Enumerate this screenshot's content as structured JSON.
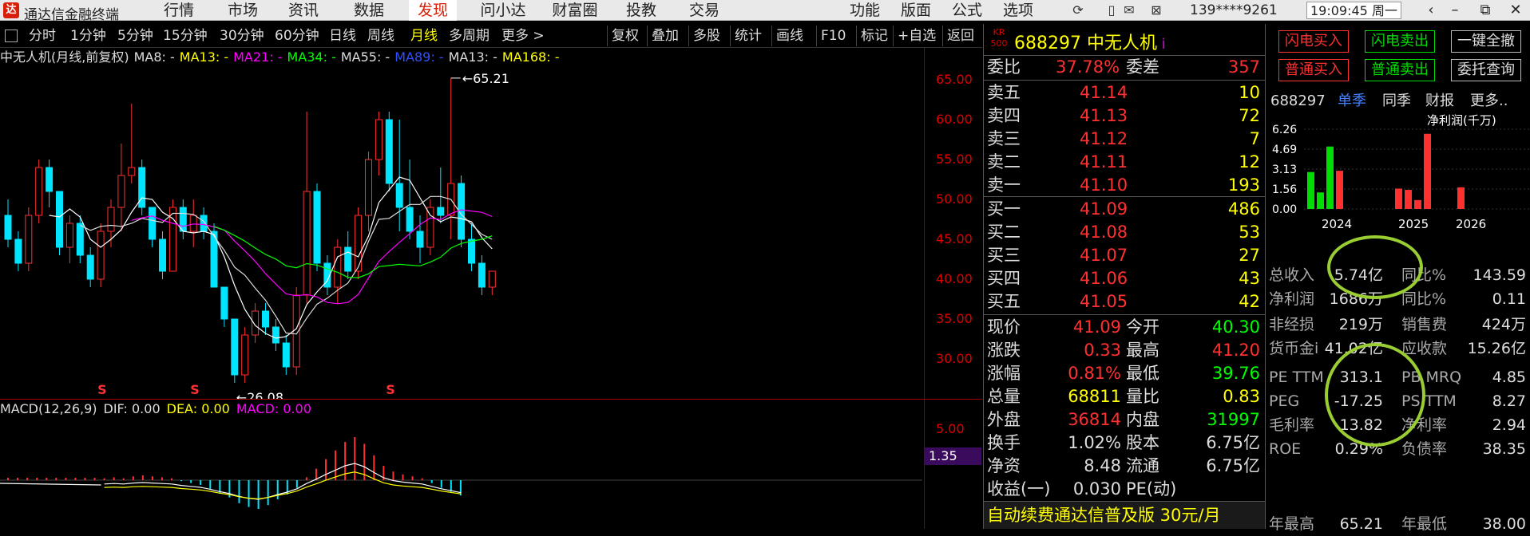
{
  "app": {
    "title": "通达信金融终端",
    "logo": "达"
  },
  "menu": [
    "行情",
    "市场",
    "资讯",
    "数据",
    "发现",
    "问小达",
    "财富圈",
    "投教",
    "交易"
  ],
  "menu_active": "发现",
  "right_menu": [
    "功能",
    "版面",
    "公式",
    "选项"
  ],
  "user_phone": "139****9261",
  "clock": "19:09:45 周一",
  "chart_toolbar": {
    "periods": [
      "分时",
      "1分钟",
      "5分钟",
      "15分钟",
      "30分钟",
      "60分钟",
      "日线",
      "周线",
      "月线",
      "多周期",
      "更多 >"
    ],
    "active": "月线",
    "tools": [
      "复权",
      "叠加",
      "多股",
      "统计",
      "画线",
      "F10",
      "标记",
      "+自选",
      "返回"
    ]
  },
  "ma_legend": [
    {
      "text": "中无人机(月线,前复权)",
      "color": "#dddddd"
    },
    {
      "text": "MA8: -",
      "color": "#dddddd"
    },
    {
      "text": "MA13: -",
      "color": "#ffff00"
    },
    {
      "text": "MA21: -",
      "color": "#ff00ff"
    },
    {
      "text": "MA34: -",
      "color": "#00ff00"
    },
    {
      "text": "MA55: -",
      "color": "#dddddd"
    },
    {
      "text": "MA89: -",
      "color": "#3050ff"
    },
    {
      "text": "MA13: -",
      "color": "#dddddd"
    },
    {
      "text": "MA168: -",
      "color": "#ffff00"
    }
  ],
  "macd_legend": [
    {
      "text": "MACD(12,26,9)",
      "color": "#dddddd"
    },
    {
      "text": "DIF: 0.00",
      "color": "#dddddd"
    },
    {
      "text": "DEA: 0.00",
      "color": "#ffff00"
    },
    {
      "text": "MACD: 0.00",
      "color": "#ff00ff"
    }
  ],
  "price_axis": [
    "65.00",
    "60.00",
    "55.00",
    "50.00",
    "45.00",
    "40.00",
    "35.00",
    "30.00"
  ],
  "macd_axis": [
    "5.00"
  ],
  "macd_axis_box": "1.35",
  "annotations": {
    "high": "65.21",
    "low": "26.08",
    "s_marks": [
      "S",
      "S",
      "S"
    ]
  },
  "chart_data": {
    "type": "candlestick",
    "title": "中无人机(月线,前复权)",
    "ylim": [
      25,
      67
    ],
    "candles": [
      [
        48,
        50,
        44,
        45
      ],
      [
        45,
        46,
        41,
        42
      ],
      [
        42,
        49,
        41,
        48
      ],
      [
        48,
        55,
        47,
        54
      ],
      [
        54,
        55,
        49,
        51
      ],
      [
        51,
        51,
        43,
        44
      ],
      [
        44,
        48,
        42,
        47
      ],
      [
        47,
        48,
        42,
        43
      ],
      [
        43,
        44,
        39,
        40
      ],
      [
        40,
        47,
        39,
        46
      ],
      [
        46,
        50,
        44,
        49
      ],
      [
        49,
        57,
        46,
        53
      ],
      [
        53,
        62,
        52,
        54
      ],
      [
        54,
        55,
        48,
        49
      ],
      [
        49,
        49,
        44,
        45
      ],
      [
        45,
        46,
        40,
        41
      ],
      [
        41,
        50,
        41,
        49
      ],
      [
        49,
        50,
        45,
        46
      ],
      [
        46,
        50,
        44,
        48
      ],
      [
        48,
        49,
        45,
        46
      ],
      [
        46,
        47,
        39,
        39
      ],
      [
        39,
        39,
        34,
        35
      ],
      [
        35,
        35,
        27,
        28
      ],
      [
        28,
        34,
        27,
        33
      ],
      [
        33,
        37,
        32,
        36
      ],
      [
        36,
        37,
        33,
        34
      ],
      [
        34,
        35,
        31,
        32
      ],
      [
        32,
        33,
        28,
        29
      ],
      [
        29,
        39,
        28,
        38
      ],
      [
        38,
        61,
        37,
        51
      ],
      [
        51,
        52,
        41,
        42
      ],
      [
        42,
        43,
        38,
        39
      ],
      [
        39,
        45,
        37,
        44
      ],
      [
        44,
        46,
        40,
        41
      ],
      [
        41,
        49,
        40,
        48
      ],
      [
        48,
        56,
        46,
        55
      ],
      [
        55,
        61,
        53,
        60
      ],
      [
        60,
        61,
        51,
        52
      ],
      [
        52,
        60,
        46,
        49
      ],
      [
        49,
        55,
        45,
        46
      ],
      [
        46,
        48,
        42,
        44
      ],
      [
        44,
        50,
        43,
        49
      ],
      [
        49,
        54,
        47,
        48
      ],
      [
        48,
        65.21,
        45,
        52
      ],
      [
        52,
        53,
        44,
        45
      ],
      [
        45,
        47,
        41,
        42
      ],
      [
        42,
        43,
        38,
        39
      ],
      [
        39,
        41,
        38,
        41
      ]
    ],
    "macd_bars": [
      0.2,
      0.3,
      0.2,
      0.4,
      0.5,
      0.4,
      0.3,
      0.2,
      -0.1,
      -0.3,
      -0.5,
      -0.9,
      -1.4,
      -1.8,
      -2.4,
      -2.8,
      -3.0,
      -2.6,
      -2.0,
      -1.5,
      -0.8,
      0.3,
      1.2,
      2.2,
      3.1,
      4.0,
      4.5,
      3.8,
      2.6,
      1.5,
      0.9,
      0.6,
      0.4,
      0.2,
      -0.3,
      -0.8,
      -1.2,
      -1.6
    ],
    "macd_xstart": 0.4
  },
  "quote": {
    "badge": "KR\n500",
    "title": "688297 中无人机",
    "weibi": {
      "label": "委比",
      "value": "37.78%",
      "label2": "委差",
      "value2": "357"
    },
    "sell": [
      {
        "label": "卖五",
        "price": "41.14",
        "qty": "10"
      },
      {
        "label": "卖四",
        "price": "41.13",
        "qty": "72"
      },
      {
        "label": "卖三",
        "price": "41.12",
        "qty": "7"
      },
      {
        "label": "卖二",
        "price": "41.11",
        "qty": "12"
      },
      {
        "label": "卖一",
        "price": "41.10",
        "qty": "193"
      }
    ],
    "buy": [
      {
        "label": "买一",
        "price": "41.09",
        "qty": "486"
      },
      {
        "label": "买二",
        "price": "41.08",
        "qty": "53"
      },
      {
        "label": "买三",
        "price": "41.07",
        "qty": "27"
      },
      {
        "label": "买四",
        "price": "41.06",
        "qty": "43"
      },
      {
        "label": "买五",
        "price": "41.05",
        "qty": "42"
      }
    ],
    "stats": [
      {
        "l": "现价",
        "v": "41.09",
        "vc": "#ff3030",
        "l2": "今开",
        "v2": "40.30",
        "v2c": "#00ff00"
      },
      {
        "l": "涨跌",
        "v": "0.33",
        "vc": "#ff3030",
        "l2": "最高",
        "v2": "41.20",
        "v2c": "#ff3030"
      },
      {
        "l": "涨幅",
        "v": "0.81%",
        "vc": "#ff3030",
        "l2": "最低",
        "v2": "39.76",
        "v2c": "#00ff00"
      },
      {
        "l": "总量",
        "v": "68811",
        "vc": "#ffff00",
        "l2": "量比",
        "v2": "0.83",
        "v2c": "#ffff00"
      },
      {
        "l": "外盘",
        "v": "36814",
        "vc": "#ff3030",
        "l2": "内盘",
        "v2": "31997",
        "v2c": "#00ff00"
      },
      {
        "l": "换手",
        "v": "1.02%",
        "vc": "#dddddd",
        "l2": "股本",
        "v2": "6.75亿",
        "v2c": "#dddddd"
      },
      {
        "l": "净资",
        "v": "8.48",
        "vc": "#dddddd",
        "l2": "流通",
        "v2": "6.75亿",
        "v2c": "#dddddd"
      },
      {
        "l": "收益(一)",
        "v": "0.030",
        "vc": "#dddddd",
        "l2": "PE(动)",
        "v2": "",
        "v2c": "#dddddd"
      }
    ],
    "ad": "自动续费通达信普及版  30元/月"
  },
  "trade_buttons": [
    {
      "text": "闪电买入",
      "color": "#ff3030"
    },
    {
      "text": "闪电卖出",
      "color": "#00dd00"
    },
    {
      "text": "一键全撤",
      "color": "#dddddd"
    },
    {
      "text": "普通买入",
      "color": "#ff3030"
    },
    {
      "text": "普通卖出",
      "color": "#00dd00"
    },
    {
      "text": "委托查询",
      "color": "#dddddd"
    }
  ],
  "fin": {
    "code": "688297",
    "tabs": [
      {
        "text": "单季",
        "color": "#4080ff"
      },
      {
        "text": "同季",
        "color": "#dddddd"
      },
      {
        "text": "财报",
        "color": "#dddddd"
      },
      {
        "text": "更多..",
        "color": "#dddddd"
      }
    ],
    "chart_title": "净利润(千万)",
    "yticks": [
      "6.26",
      "4.69",
      "3.13",
      "1.56",
      "0.00"
    ],
    "years": [
      "2024",
      "2025",
      "2026"
    ],
    "bars": [
      {
        "v": 2.9,
        "c": "#00dd00"
      },
      {
        "v": 1.3,
        "c": "#00dd00"
      },
      {
        "v": 4.9,
        "c": "#00dd00"
      },
      {
        "v": 3.0,
        "c": "#ff3030"
      },
      {
        "v": 1.6,
        "c": "#ff3030"
      },
      {
        "v": 1.5,
        "c": "#ff3030"
      },
      {
        "v": 0.7,
        "c": "#ff3030"
      },
      {
        "v": 5.9,
        "c": "#ff3030"
      },
      {
        "v": 1.7,
        "c": "#ff3030"
      }
    ],
    "rows": [
      {
        "a": "总收入",
        "b": "5.74亿",
        "c": "同比%",
        "d": "143.59"
      },
      {
        "a": "净利润",
        "b": "1686万",
        "c": "同比%",
        "d": "0.11"
      },
      {
        "a": "非经损",
        "b": "219万",
        "c": "销售费",
        "d": "424万"
      },
      {
        "a": "货币金i",
        "b": "41.02亿",
        "c": "应收款",
        "d": "15.26亿"
      },
      {
        "a": "PE TTM",
        "b": "313.1",
        "c": "PB MRQ",
        "d": "4.85"
      },
      {
        "a": "PEG",
        "b": "-17.25",
        "c": "PS TTM",
        "d": "8.27"
      },
      {
        "a": "毛利率",
        "b": "13.82",
        "c": "净利率",
        "d": "2.94"
      },
      {
        "a": "ROE",
        "b": "0.29%",
        "c": "负债率",
        "d": "38.35"
      },
      {
        "a": "年最高",
        "b": "65.21",
        "c": "年最低",
        "d": "38.00"
      }
    ]
  }
}
